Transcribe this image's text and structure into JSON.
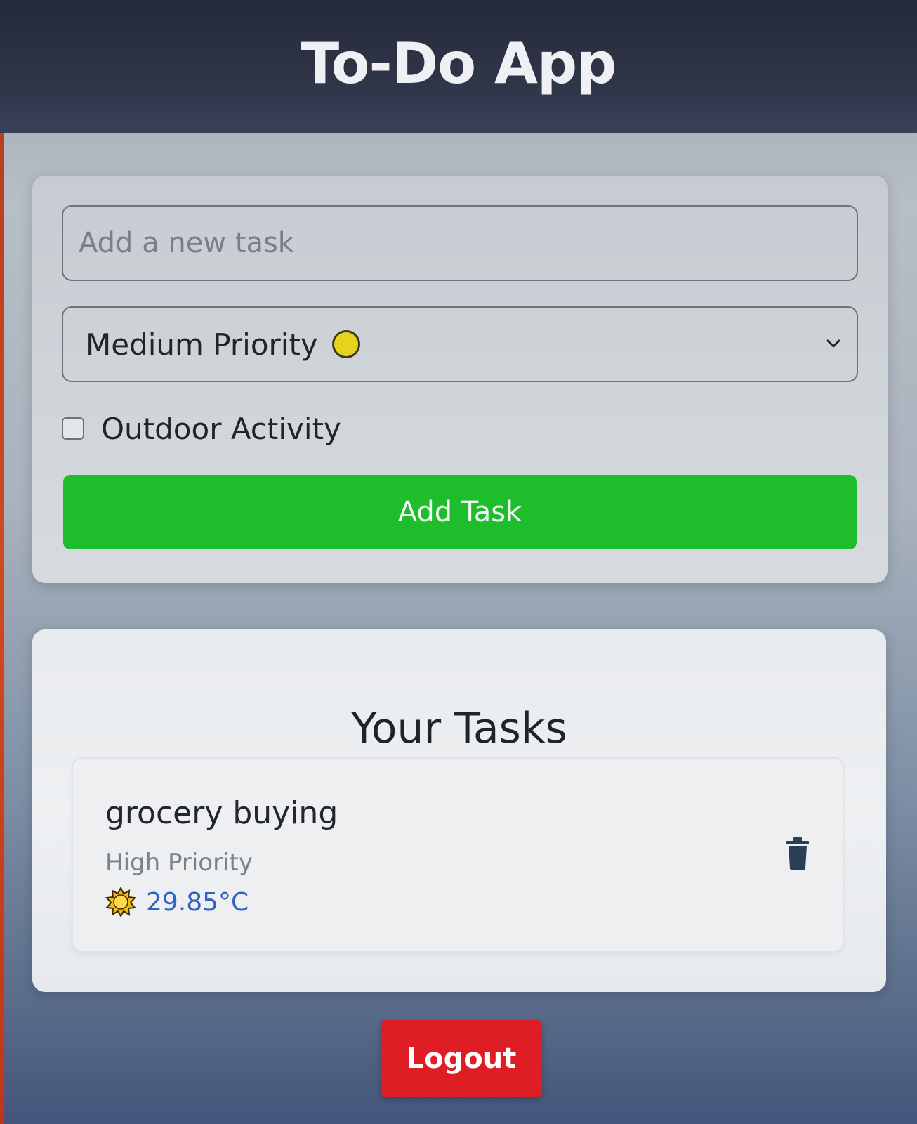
{
  "header": {
    "title": "To-Do App"
  },
  "form": {
    "task_placeholder": "Add a new task",
    "priority": {
      "selected": "Medium Priority",
      "indicator_color": "#e6d41c"
    },
    "outdoor_checkbox": {
      "label": "Outdoor Activity",
      "checked": false
    },
    "add_button_label": "Add Task",
    "add_button_color": "#1dbd2b"
  },
  "tasks": {
    "heading": "Your Tasks",
    "items": [
      {
        "name": "grocery buying",
        "priority": "High Priority",
        "weather_icon": "sun-icon",
        "temperature": "29.85°C",
        "delete_icon": "trash-icon"
      }
    ]
  },
  "logout": {
    "label": "Logout",
    "color": "#de1d25"
  }
}
